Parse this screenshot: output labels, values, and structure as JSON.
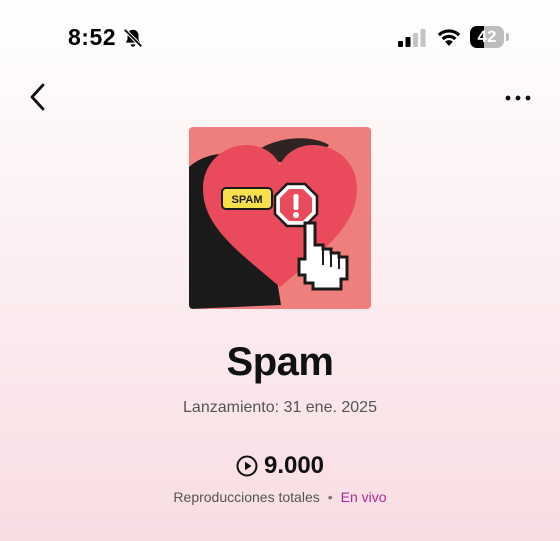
{
  "status_bar": {
    "time": "8:52",
    "battery_level": "42",
    "battery_fraction": 0.42
  },
  "nav": {
    "back_icon": "chevron-left-icon",
    "more_icon": "more-horizontal-icon"
  },
  "cover": {
    "badge_text": "SPAM",
    "colors": {
      "background": "#ef7f7c",
      "heart": "#e94a5c",
      "shadow": "#1b1a1a",
      "badge": "#f7e04a"
    }
  },
  "track": {
    "title": "Spam",
    "release": "Lanzamiento: 31 ene. 2025"
  },
  "stats": {
    "plays": "9.000",
    "plays_label": "Reproducciones totales",
    "separator": "•",
    "live_label": "En vivo"
  },
  "colors": {
    "accent": "#b1269a"
  }
}
